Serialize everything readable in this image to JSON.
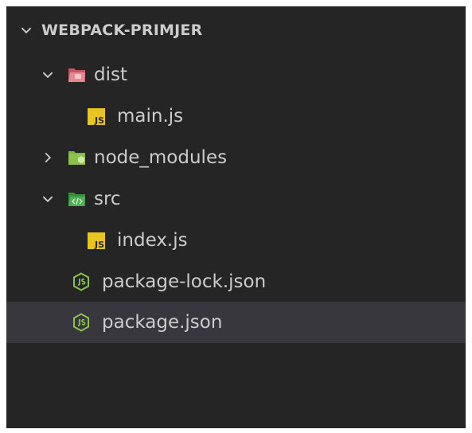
{
  "explorer": {
    "root_label": "WEBPACK-PRIMJER",
    "items": [
      {
        "label": "dist",
        "icon": "folder-dist-open-icon",
        "expanded": true
      },
      {
        "label": "main.js",
        "icon": "javascript-file-icon"
      },
      {
        "label": "node_modules",
        "icon": "folder-node-icon",
        "expanded": false
      },
      {
        "label": "src",
        "icon": "folder-src-open-icon",
        "expanded": true
      },
      {
        "label": "index.js",
        "icon": "javascript-file-icon"
      },
      {
        "label": "package-lock.json",
        "icon": "nodejs-json-icon"
      },
      {
        "label": "package.json",
        "icon": "nodejs-json-icon",
        "selected": true
      }
    ]
  },
  "colors": {
    "background": "#252526",
    "selected_row": "#37373d",
    "text": "#cccccc",
    "js_badge": "#e8c520",
    "dist_folder": "#e0707a",
    "node_folder": "#8bc34a",
    "src_folder": "#4caf50",
    "nodejs_icon": "#8bc34a"
  }
}
